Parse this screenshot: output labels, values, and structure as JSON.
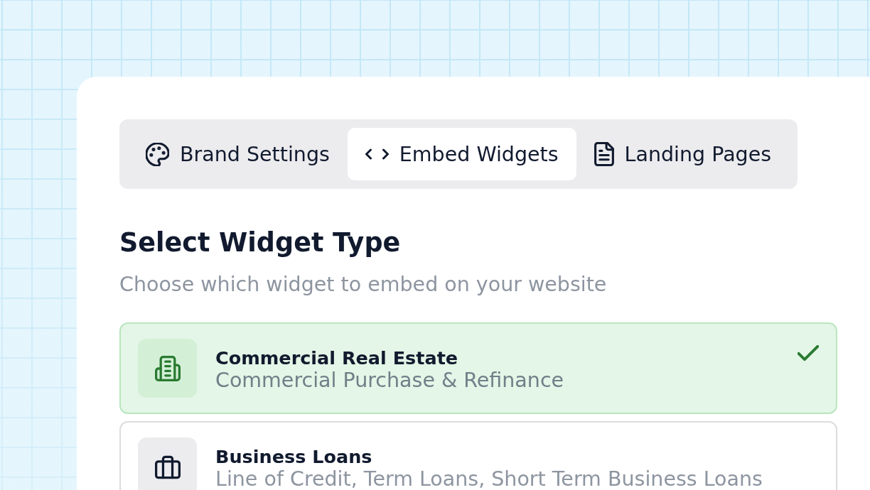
{
  "tabs": [
    {
      "label": "Brand Settings",
      "selected": false
    },
    {
      "label": "Embed Widgets",
      "selected": true
    },
    {
      "label": "Landing Pages",
      "selected": false
    }
  ],
  "section": {
    "title": "Select Widget Type",
    "subtitle": "Choose which widget to embed on your website"
  },
  "widget_types": [
    {
      "title": "Commercial Real Estate",
      "subtitle": "Commercial Purchase & Refinance",
      "selected": true
    },
    {
      "title": "Business Loans",
      "subtitle": "Line of Credit, Term Loans, Short Term Business Loans",
      "selected": false
    }
  ]
}
